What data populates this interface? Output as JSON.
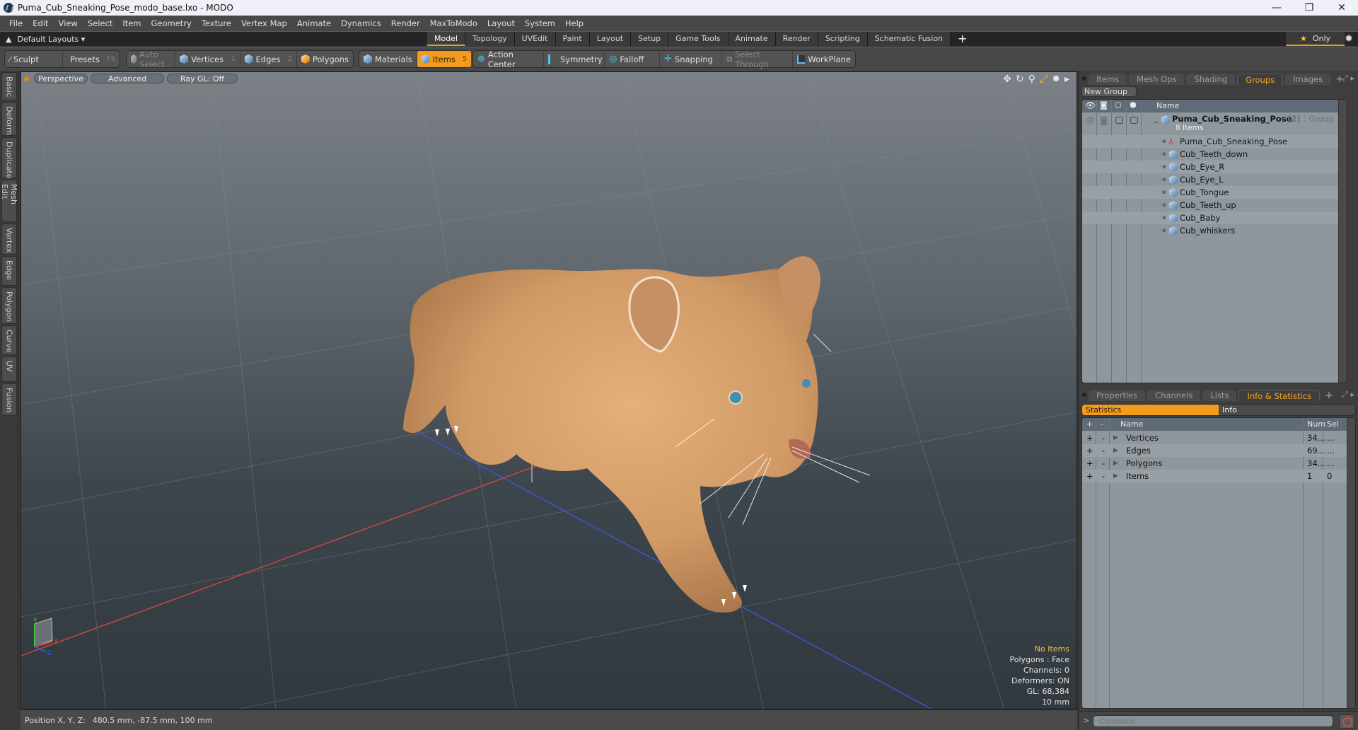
{
  "window": {
    "title": "Puma_Cub_Sneaking_Pose_modo_base.lxo - MODO",
    "controls": [
      "—",
      "❐",
      "✕"
    ]
  },
  "menu": [
    "File",
    "Edit",
    "View",
    "Select",
    "Item",
    "Geometry",
    "Texture",
    "Vertex Map",
    "Animate",
    "Dynamics",
    "Render",
    "MaxToModo",
    "Layout",
    "System",
    "Help"
  ],
  "layout_bar": {
    "layouts_label": "Default Layouts ▾",
    "tabs": [
      "Model",
      "Topology",
      "UVEdit",
      "Paint",
      "Layout",
      "Setup",
      "Game Tools",
      "Animate",
      "Render",
      "Scripting",
      "Schematic Fusion"
    ],
    "active_tab": "Model",
    "add_tab": "+",
    "only_label": "Only",
    "star": "★"
  },
  "toolbar": {
    "sculpt": "Sculpt",
    "presets": "Presets",
    "presets_key": "F6",
    "auto_select": "Auto Select",
    "vertices": "Vertices",
    "vertices_key": "1",
    "edges": "Edges",
    "edges_key": "2",
    "polygons": "Polygons",
    "materials": "Materials",
    "items": "Items",
    "items_key": "5",
    "action_center": "Action Center",
    "symmetry": "Symmetry",
    "falloff": "Falloff",
    "snapping": "Snapping",
    "select_through": "Select Through",
    "workplane": "WorkPlane"
  },
  "left_tabs": [
    "Basic",
    "Deform",
    "Duplicate",
    "Mesh Edit",
    "Vertex",
    "Edge",
    "Polygon",
    "Curve",
    "UV",
    "Fusion"
  ],
  "viewport": {
    "view_mode": "Perspective",
    "shading": "Advanced",
    "raygl": "Ray GL: Off",
    "info": {
      "selection": "No Items",
      "polygons": "Polygons : Face",
      "channels": "Channels: 0",
      "deformers": "Deformers: ON",
      "gl": "GL: 68,384",
      "grid": "10 mm"
    },
    "axis_labels": {
      "x": "X",
      "y": "Y",
      "z": "Z"
    }
  },
  "status": {
    "label": "Position X, Y, Z:",
    "value": "480.5 mm, -87.5 mm, 100 mm"
  },
  "groups_panel": {
    "tabs": [
      "Items",
      "Mesh Ops",
      "Shading",
      "Groups",
      "Images"
    ],
    "active_tab": "Groups",
    "new_group": "New Group",
    "column_name": "Name",
    "group": {
      "name": "Puma_Cub_Sneaking_Pose",
      "count": "(2)",
      "type": ": Group",
      "items_count": "8 Items"
    },
    "items": [
      {
        "name": "Puma_Cub_Sneaking_Pose",
        "icon": "locator-icon"
      },
      {
        "name": "Cub_Teeth_down",
        "icon": "mesh-icon"
      },
      {
        "name": "Cub_Eye_R",
        "icon": "mesh-icon"
      },
      {
        "name": "Cub_Eye_L",
        "icon": "mesh-icon"
      },
      {
        "name": "Cub_Tongue",
        "icon": "mesh-icon"
      },
      {
        "name": "Cub_Teeth_up",
        "icon": "mesh-icon"
      },
      {
        "name": "Cub_Baby",
        "icon": "mesh-icon"
      },
      {
        "name": "Cub_whiskers",
        "icon": "mesh-icon"
      }
    ]
  },
  "stats_panel": {
    "tabs": [
      "Properties",
      "Channels",
      "Lists",
      "Info & Statistics"
    ],
    "active_tab": "Info & Statistics",
    "subtabs": [
      "Statistics",
      "Info"
    ],
    "active_subtab": "Statistics",
    "columns": {
      "plus": "+",
      "minus": "-",
      "name": "Name",
      "num": "Num",
      "sel": "Sel"
    },
    "rows": [
      {
        "name": "Vertices",
        "num": "34...",
        "sel": "..."
      },
      {
        "name": "Edges",
        "num": "69...",
        "sel": "..."
      },
      {
        "name": "Polygons",
        "num": "34...",
        "sel": "..."
      },
      {
        "name": "Items",
        "num": "1",
        "sel": "0"
      }
    ]
  },
  "command": {
    "prompt": ">",
    "placeholder": "Command"
  },
  "colors": {
    "accent": "#f29b1d",
    "info_highlight": "#f7c43c"
  }
}
